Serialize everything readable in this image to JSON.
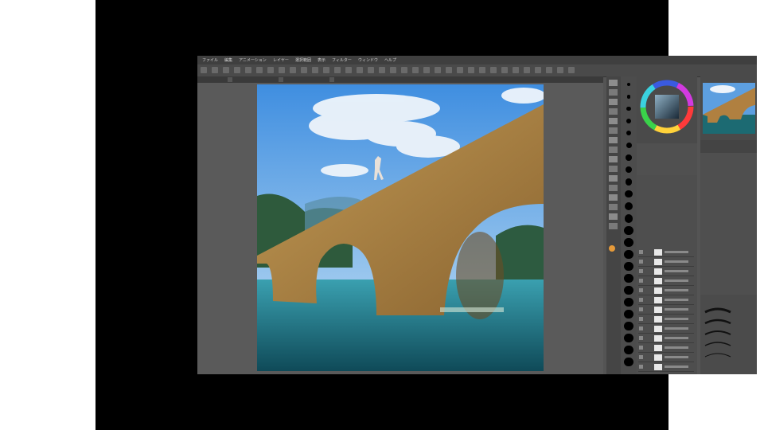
{
  "app": {
    "menu": [
      "ファイル",
      "編集",
      "アニメーション",
      "レイヤー",
      "選択範囲",
      "表示",
      "フィルター",
      "ウィンドウ",
      "ヘルプ"
    ]
  },
  "colors": {
    "letterbox": "#000000",
    "panel_bg": "#4a4a4a",
    "workspace_bg": "#5a5a5a",
    "sky": "#5d9fe0",
    "water": "#1c6a72",
    "bridge": "#b08040"
  },
  "icons": {
    "tools": [
      "zoom-icon",
      "move-icon",
      "select-icon",
      "lasso-icon",
      "eyedropper-icon",
      "pen-icon",
      "pencil-icon",
      "brush-icon",
      "airbrush-icon",
      "decoration-icon",
      "eraser-icon",
      "blend-icon",
      "fill-icon",
      "gradient-icon",
      "figure-icon",
      "text-icon"
    ]
  }
}
